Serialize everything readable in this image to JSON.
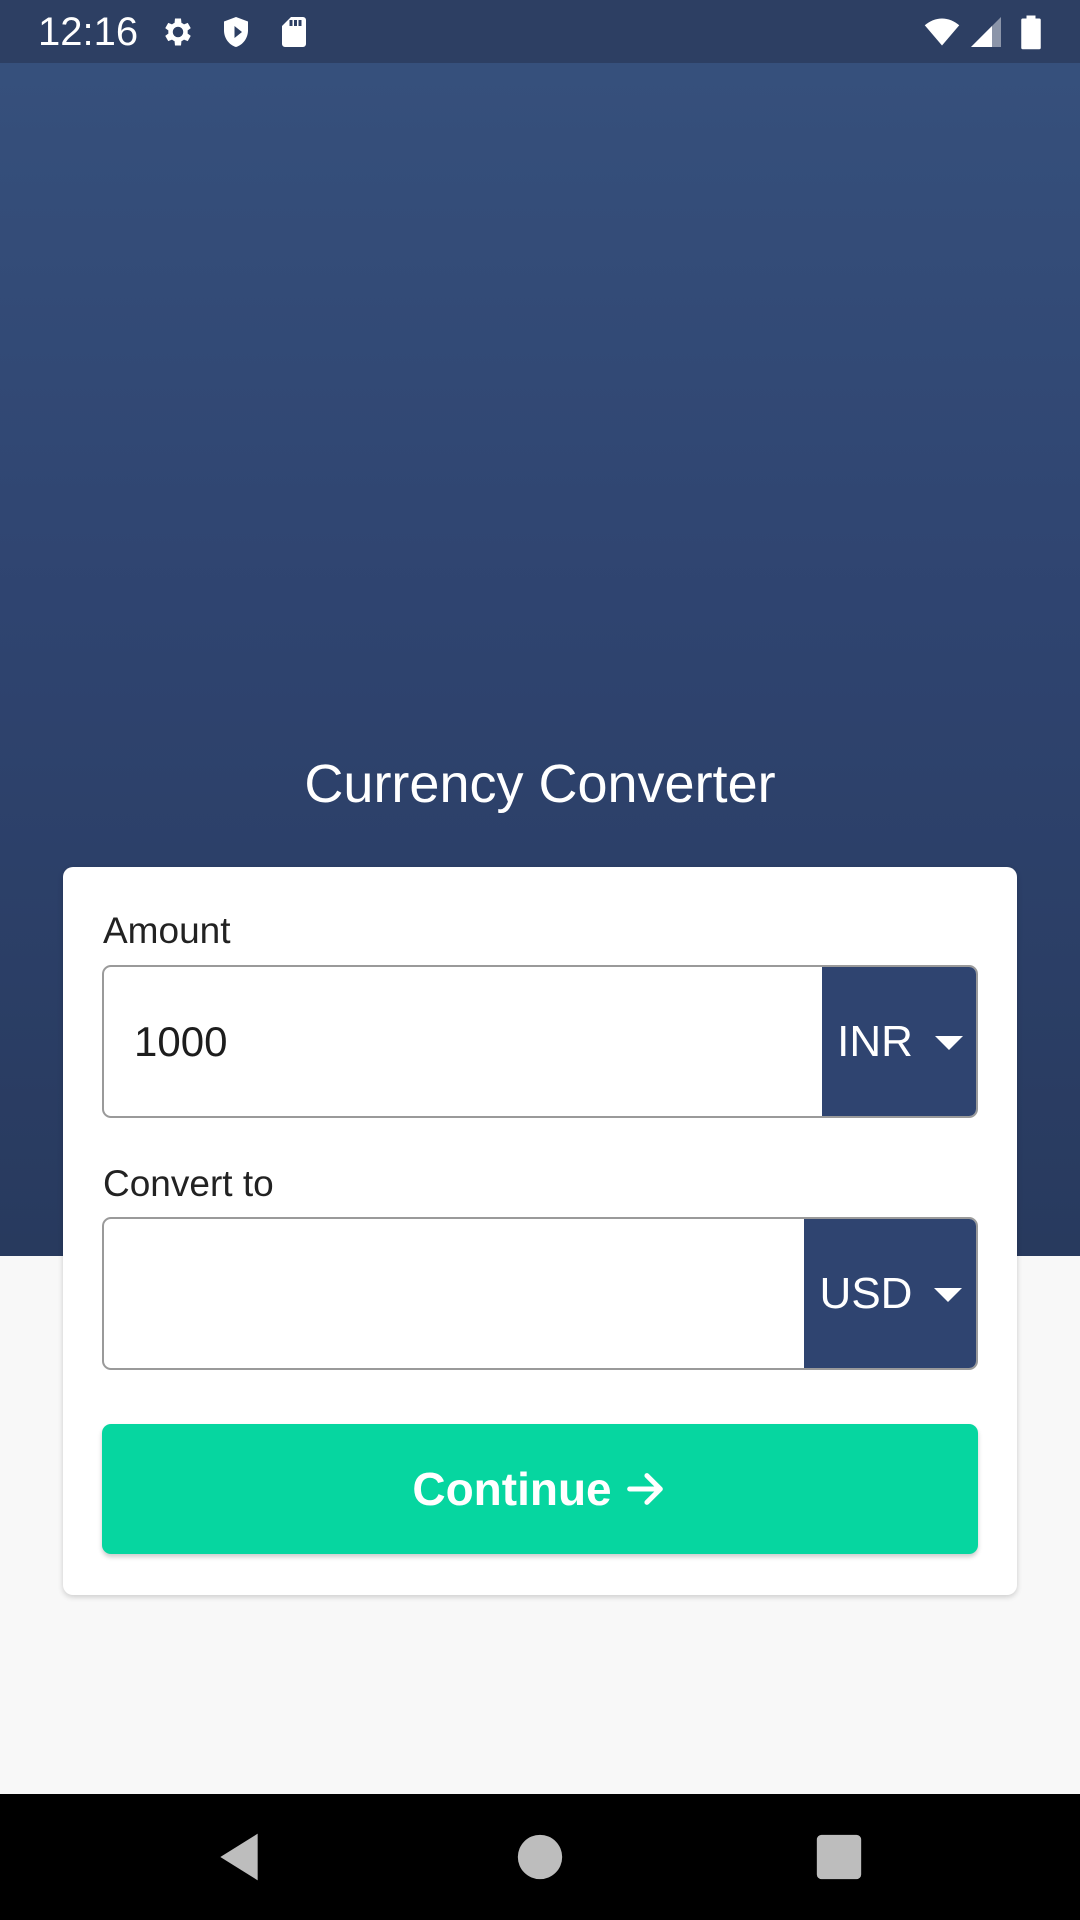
{
  "status_bar": {
    "time": "12:16",
    "left_icons": [
      "gear-icon",
      "shield-icon",
      "sd-card-icon"
    ],
    "right_icons": [
      "wifi-icon",
      "signal-icon",
      "battery-icon"
    ],
    "background_color": "#2d3f63"
  },
  "header": {
    "title": "Currency Converter",
    "gradient_top": "#36507c",
    "gradient_bottom": "#283a5e"
  },
  "form": {
    "amount": {
      "label": "Amount",
      "value": "1000",
      "currency": "INR"
    },
    "convert_to": {
      "label": "Convert to",
      "value": "",
      "currency": "USD"
    },
    "continue_button": {
      "label": "Continue",
      "icon": "arrow-right-icon",
      "color": "#06d6a0"
    }
  },
  "nav_bar": {
    "buttons": [
      "back-icon",
      "home-icon",
      "recents-icon"
    ]
  }
}
